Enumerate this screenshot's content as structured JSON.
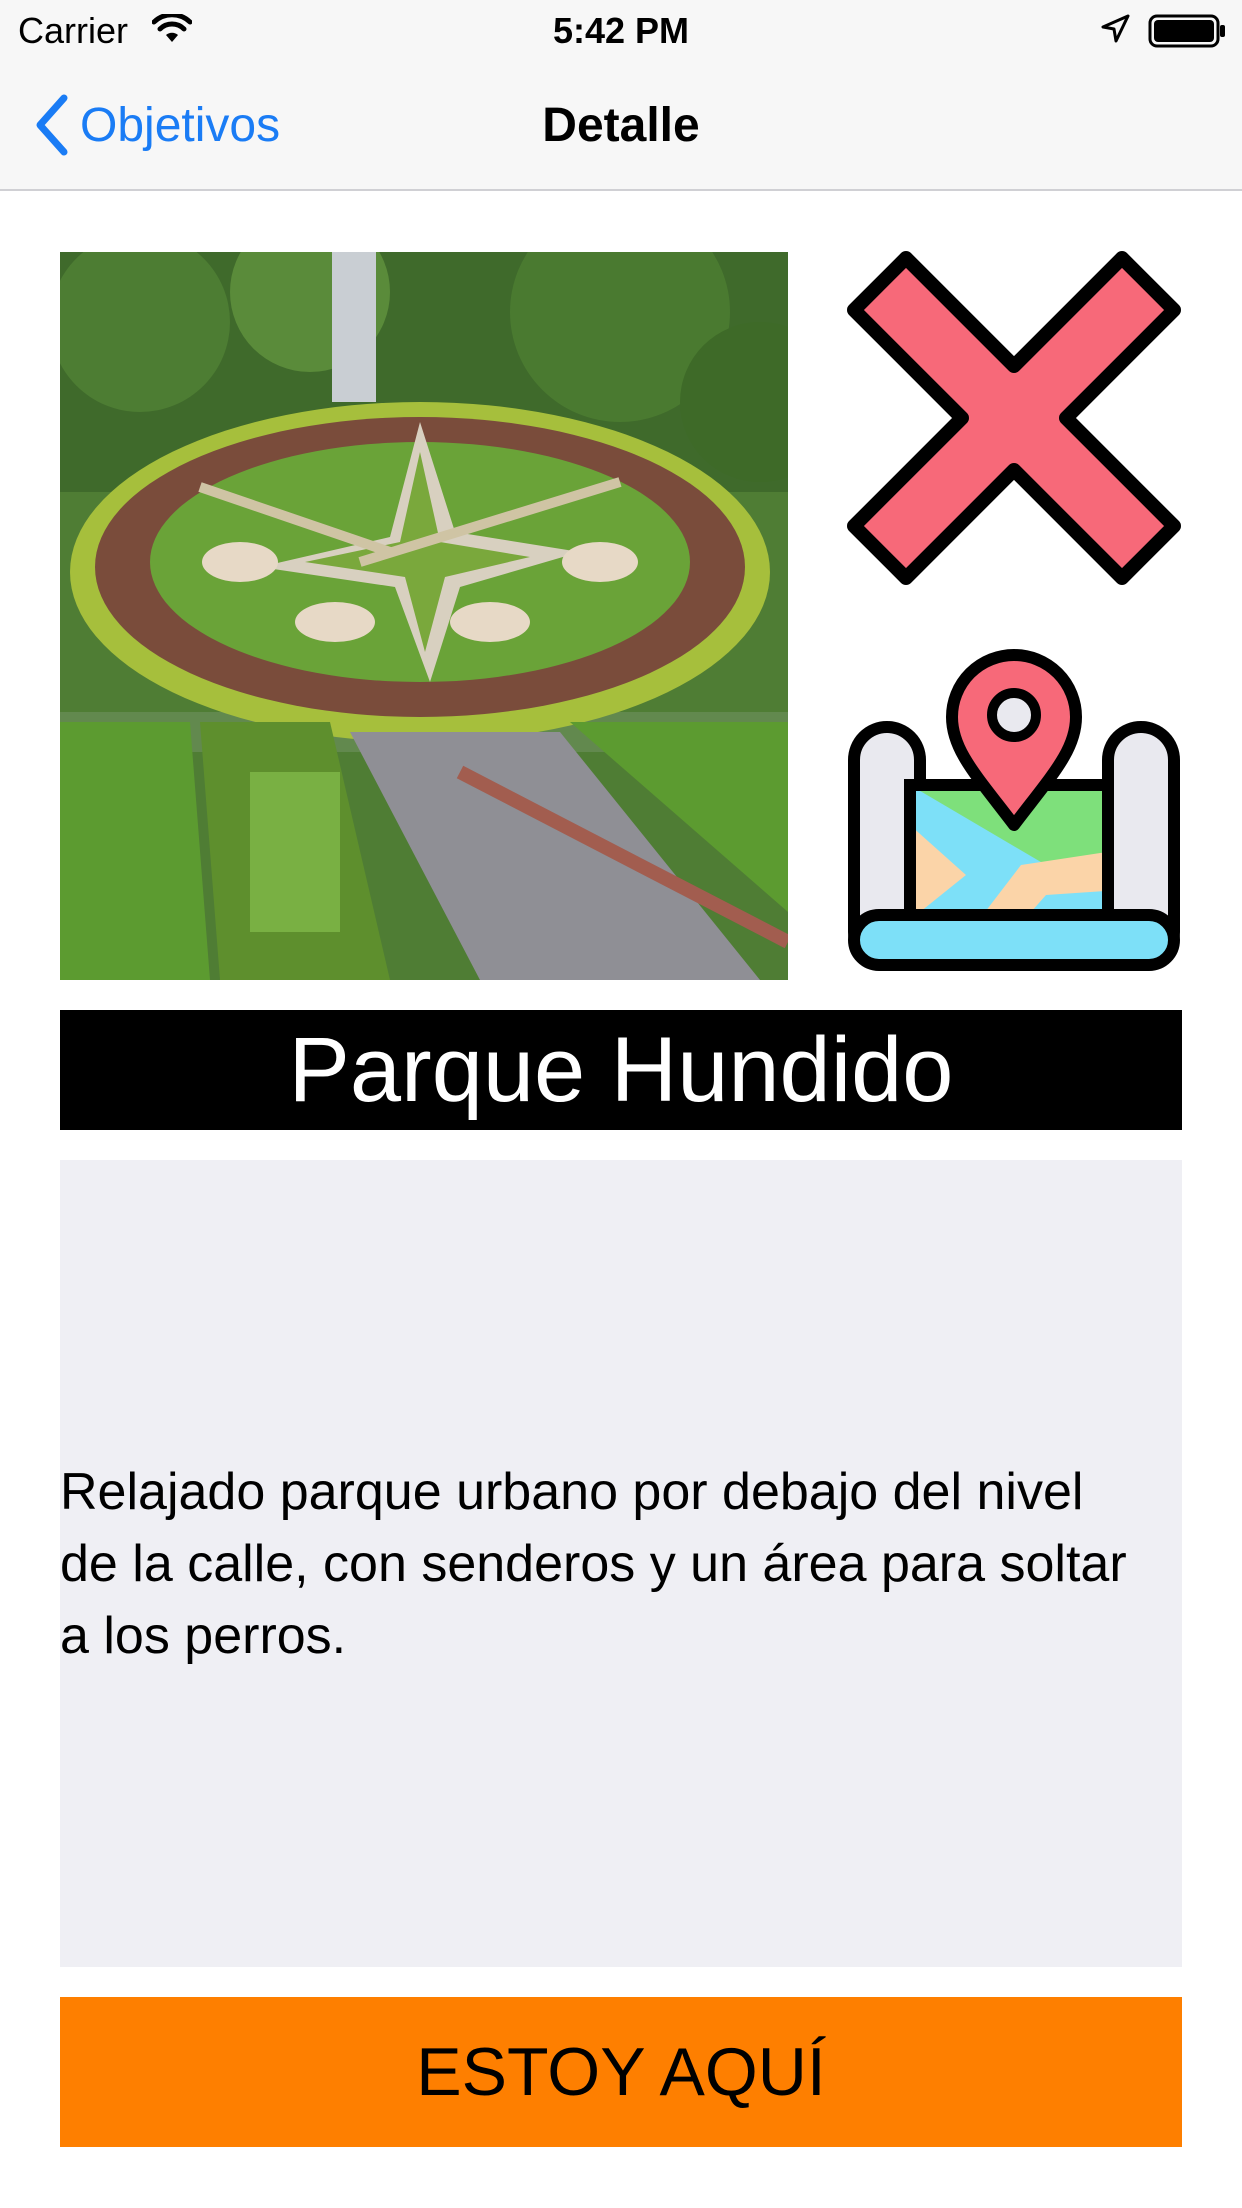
{
  "status_bar": {
    "carrier": "Carrier",
    "time": "5:42 PM",
    "icons": [
      "wifi-icon",
      "location-arrow-icon",
      "battery-icon"
    ]
  },
  "nav": {
    "back_label": "Objetivos",
    "title": "Detalle",
    "back_icon": "chevron-left-icon"
  },
  "place": {
    "image_description_icon": "park-photo",
    "name": "Parque Hundido",
    "description": "Relajado parque urbano por debajo del nivel de la calle, con senderos y un área para soltar a los perros."
  },
  "actions": {
    "close_icon": "close-icon",
    "map_icon": "map-pin-icon",
    "cta_label": "ESTOY AQUÍ"
  },
  "colors": {
    "accent_blue": "#1a7cf5",
    "cta_orange": "#fe7f00",
    "title_bg": "#000000",
    "desc_bg": "#efeff4",
    "x_red": "#f76979",
    "map_green": "#7ee07b",
    "map_blue": "#7de0f8"
  }
}
